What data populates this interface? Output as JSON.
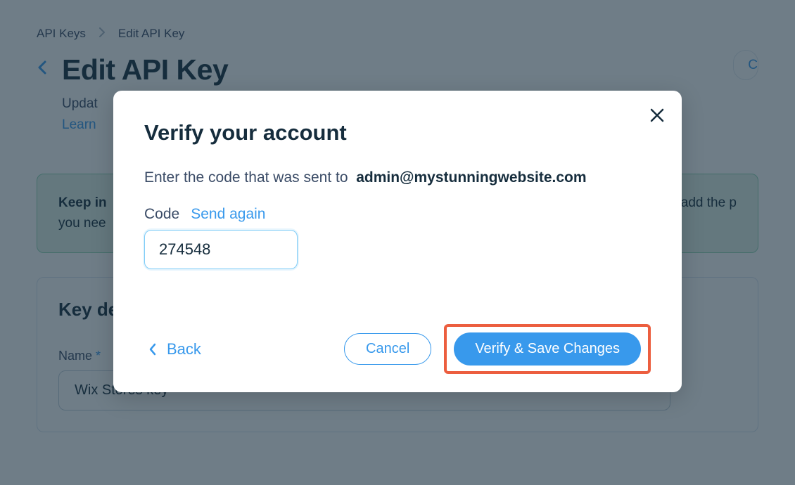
{
  "breadcrumb": {
    "level1": "API Keys",
    "level2": "Edit API Key"
  },
  "page": {
    "title": "Edit API Key",
    "subtitle_prefix": "Updat",
    "learn_prefix": "Learn",
    "truncated_right": "C"
  },
  "info": {
    "title_prefix": "Keep in",
    "line1_suffix": "y add the p",
    "line2_prefix": "you nee"
  },
  "panel": {
    "title_prefix": "Key de",
    "name_label": "Name",
    "name_value": "Wix Stores key"
  },
  "modal": {
    "title": "Verify your account",
    "prompt": "Enter the code that was sent to",
    "email": "admin@mystunningwebsite.com",
    "code_label": "Code",
    "send_again": "Send again",
    "code_value": "274548",
    "back_label": "Back",
    "cancel_label": "Cancel",
    "verify_label": "Verify & Save Changes"
  }
}
